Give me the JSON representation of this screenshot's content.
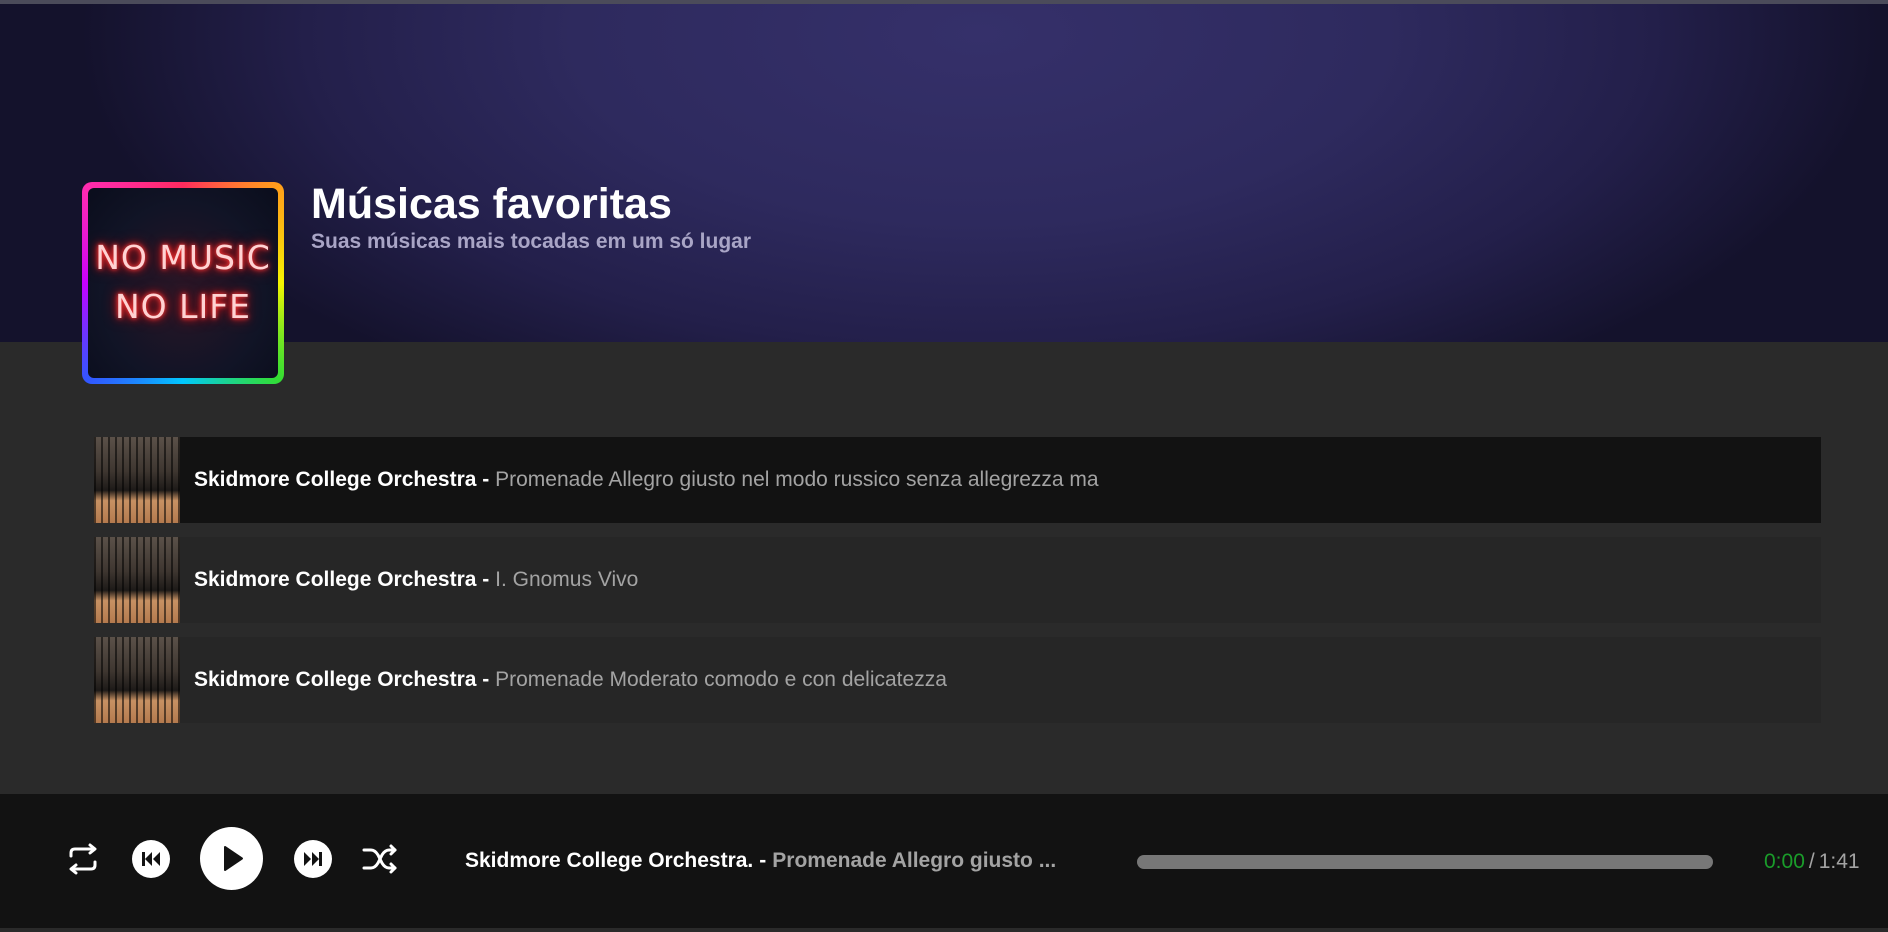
{
  "playlist": {
    "title": "Músicas favoritas",
    "subtitle": "Suas músicas mais tocadas em um só lugar",
    "cover_text_line1": "NO MUSIC",
    "cover_text_line2": "NO LIFE"
  },
  "tracks": [
    {
      "artist": "Skidmore College Orchestra",
      "separator": " - ",
      "title": "Promenade Allegro giusto nel modo russico senza allegrezza ma",
      "active": true
    },
    {
      "artist": "Skidmore College Orchestra",
      "separator": " - ",
      "title": "I. Gnomus Vivo",
      "active": false
    },
    {
      "artist": "Skidmore College Orchestra",
      "separator": " - ",
      "title": "Promenade Moderato comodo e con delicatezza",
      "active": false
    }
  ],
  "player": {
    "controls": [
      "repeat-icon",
      "previous-icon",
      "play-icon",
      "next-icon",
      "shuffle-icon"
    ],
    "now_playing_artist": "Skidmore College Orchestra.",
    "now_playing_separator": "-",
    "now_playing_title": "Promenade Allegro giusto ...",
    "current_time": "0:00",
    "time_separator": "/",
    "duration": "1:41",
    "progress_fraction": 0
  },
  "colors": {
    "hero_background": "#2e2a5e",
    "page_background": "#2a2a2a",
    "player_background": "#121212",
    "current_time": "#1a9c2a",
    "progress_track": "#777777"
  }
}
